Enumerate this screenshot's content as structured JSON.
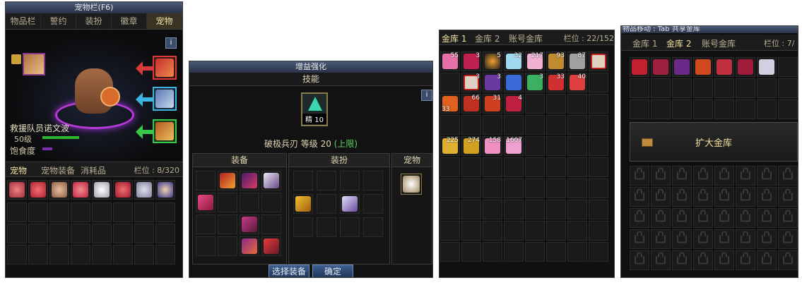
{
  "pet_panel": {
    "title": "宠物栏(F6)",
    "tabs": [
      "物品栏",
      "誓约",
      "装扮",
      "徽章",
      "宠物"
    ],
    "info_label": "i",
    "pet_name": "救援队员诺文波",
    "pet_level": "50级",
    "satiety_label": "饱食度",
    "sub_tabs": [
      "宠物",
      "宠物装备",
      "消耗品"
    ],
    "slots_label": "栏位 : 8/320"
  },
  "enhance_panel": {
    "title": "增益强化",
    "skill_header": "技能",
    "skill_badge": "精 10",
    "skill_name": "破极兵刃 等级 20",
    "skill_limit": "(上限)",
    "info_label": "i",
    "equip_header": "装备",
    "outfit_header": "装扮",
    "pet_header": "宠物",
    "select_button": "选择装备",
    "confirm_button": "确定"
  },
  "vault_panel_1": {
    "tabs": [
      "金库 1",
      "金库 2",
      "账号金库"
    ],
    "slots_label": "栏位 : 22/152",
    "row1_counts": [
      "55",
      "3",
      "5",
      "32",
      "217",
      "93",
      "87",
      ""
    ],
    "row2_counts": [
      "",
      "3",
      "3",
      "",
      "3",
      "33",
      "40",
      ""
    ],
    "row3_counts": [
      "33",
      "66",
      "31",
      "4",
      "",
      "",
      "",
      ""
    ],
    "row4_counts": [
      "225",
      "274",
      "158",
      "1607",
      "",
      "",
      "",
      ""
    ]
  },
  "vault_panel_2": {
    "title": "物品移动 : Tab    共享金库",
    "tabs": [
      "金库 1",
      "金库 2",
      "账号金库"
    ],
    "slots_label": "栏位 : 7/",
    "expand_button": "扩大金库"
  },
  "colors": {
    "accent_gold": "#f0e2a0",
    "limit_green": "#5fd65f",
    "hp_green": "#2db52d",
    "satiety_purple": "#7a2fb3",
    "button_blue": "#2b4a78"
  }
}
